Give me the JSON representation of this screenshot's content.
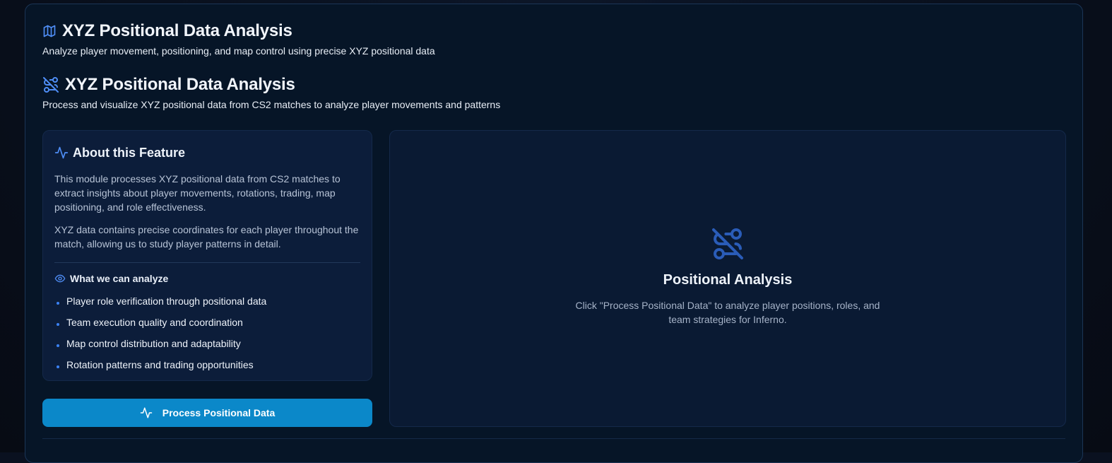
{
  "header": {
    "title": "XYZ Positional Data Analysis",
    "subtitle": "Analyze player movement, positioning, and map control using precise XYZ positional data",
    "title_icon": "map-icon"
  },
  "section": {
    "title": "XYZ Positional Data Analysis",
    "subtitle": "Process and visualize XYZ positional data from CS2 matches to analyze player movements and patterns",
    "title_icon": "route-off-icon"
  },
  "about": {
    "title": "About this Feature",
    "title_icon": "activity-icon",
    "paragraph1": "This module processes XYZ positional data from CS2 matches to extract insights about player movements, rotations, trading, map positioning, and role effectiveness.",
    "paragraph2": "XYZ data contains precise coordinates for each player throughout the match, allowing us to study player patterns in detail.",
    "analyze_title": "What we can analyze",
    "analyze_icon": "eye-icon",
    "items": [
      "Player role verification through positional data",
      "Team execution quality and coordination",
      "Map control distribution and adaptability",
      "Rotation patterns and trading opportunities"
    ]
  },
  "actions": {
    "process_label": "Process Positional Data",
    "process_icon": "activity-icon"
  },
  "empty_state": {
    "icon": "route-off-icon",
    "title": "Positional Analysis",
    "description": "Click \"Process Positional Data\" to analyze player positions, roles, and team strategies for Inferno."
  },
  "colors": {
    "accent": "#3b82f6",
    "button": "#0b88c9",
    "panel_bg": "#061527",
    "card_bg": "#0c1d3a",
    "muted_icon": "#2a5cb8"
  }
}
